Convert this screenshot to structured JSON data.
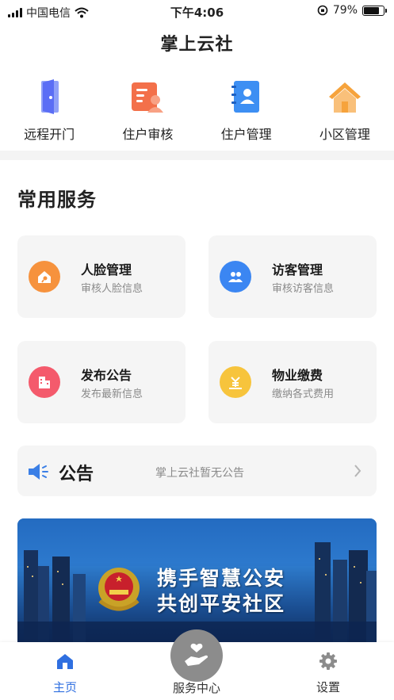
{
  "status_bar": {
    "carrier": "中国电信",
    "time": "下午4:06",
    "battery_percent": "79%",
    "battery_level": 0.79
  },
  "app": {
    "title": "掌上云社"
  },
  "quick_actions": [
    {
      "label": "远程开门",
      "icon": "door-icon",
      "color": "#5b6ef5"
    },
    {
      "label": "住户审核",
      "icon": "resident-review-icon",
      "color": "#f3704a"
    },
    {
      "label": "住户管理",
      "icon": "contact-book-icon",
      "color": "#3d8ff3"
    },
    {
      "label": "小区管理",
      "icon": "house-icon",
      "color": "#f6a33c"
    }
  ],
  "services": {
    "title": "常用服务",
    "items": [
      {
        "title": "人脸管理",
        "subtitle": "审核人脸信息",
        "icon": "face-house-icon",
        "color": "#f6923d"
      },
      {
        "title": "访客管理",
        "subtitle": "审核访客信息",
        "icon": "visitors-icon",
        "color": "#3b86f2"
      },
      {
        "title": "发布公告",
        "subtitle": "发布最新信息",
        "icon": "building-icon",
        "color": "#f45a6c"
      },
      {
        "title": "物业缴费",
        "subtitle": "缴纳各式费用",
        "icon": "payment-icon",
        "color": "#f7c43c"
      }
    ]
  },
  "notice": {
    "title": "公告",
    "text": "掌上云社暂无公告"
  },
  "banner": {
    "line1": "携手智慧公安",
    "line2": "共创平安社区"
  },
  "tabbar": {
    "home": "主页",
    "service": "服务中心",
    "settings": "设置",
    "active_color": "#2f6fe0"
  }
}
